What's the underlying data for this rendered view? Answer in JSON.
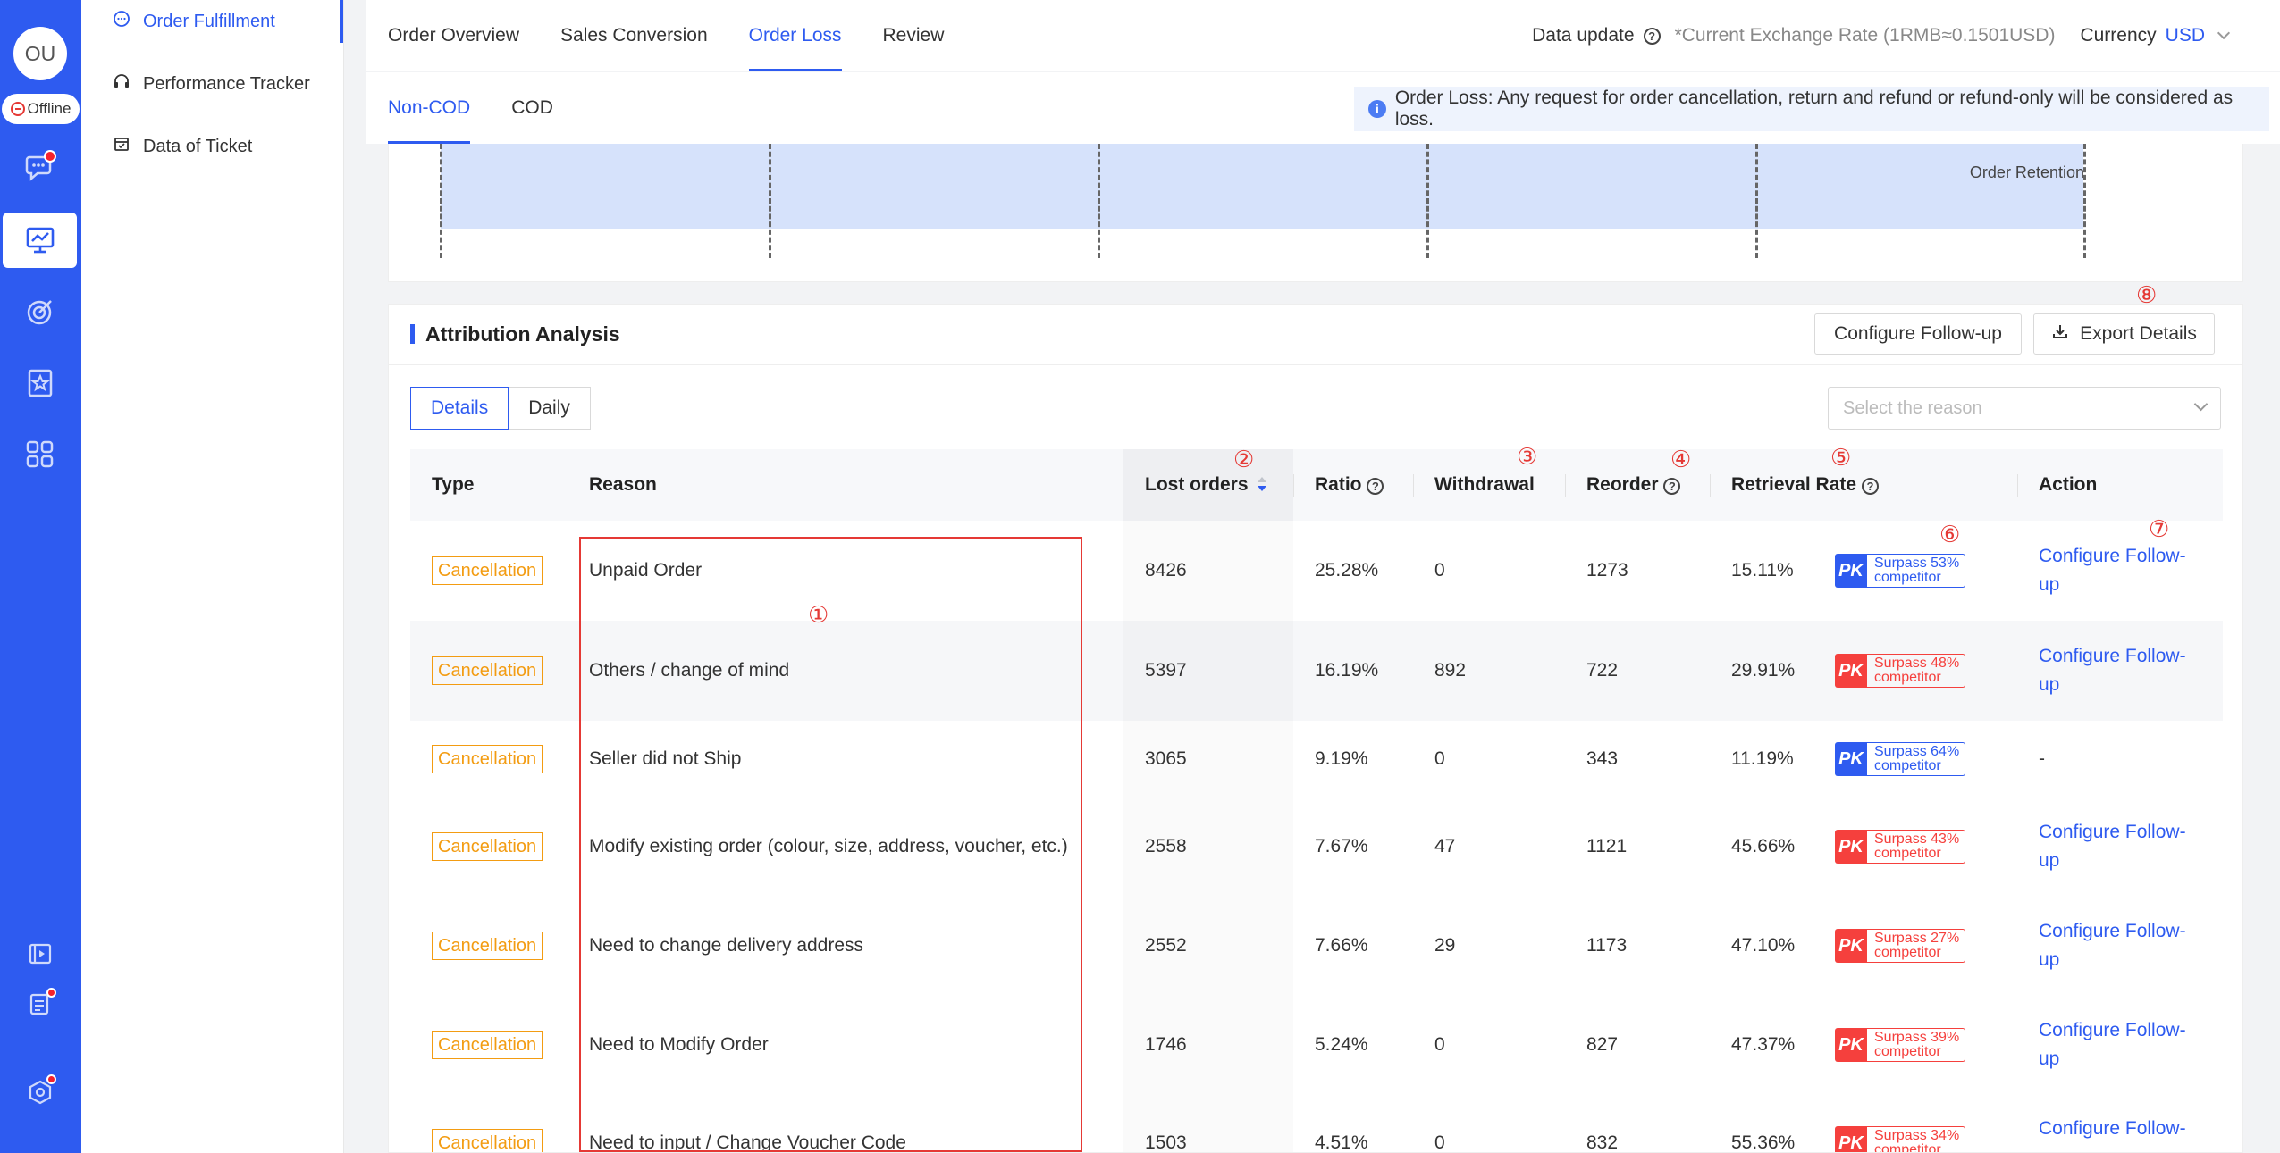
{
  "rail": {
    "avatar": "OU",
    "status": "Offline"
  },
  "subnav": {
    "items": [
      {
        "label": "Order Fulfillment",
        "icon": "chat-bubble-icon"
      },
      {
        "label": "Performance Tracker",
        "icon": "headset-icon"
      },
      {
        "label": "Data of Ticket",
        "icon": "calendar-icon"
      }
    ]
  },
  "topbar": {
    "tabs": [
      "Order Overview",
      "Sales Conversion",
      "Order Loss",
      "Review"
    ],
    "data_update": "Data update",
    "exchange": "*Current Exchange Rate (1RMB≈0.1501USD)",
    "currency_label": "Currency",
    "currency_value": "USD"
  },
  "subbar": {
    "tabs": [
      "Non-COD",
      "COD"
    ],
    "info": "Order Loss: Any request for order cancellation, return and refund or refund-only will be considered as loss."
  },
  "strip": {
    "label": "Order Retention"
  },
  "card": {
    "title": "Attribution Analysis",
    "configure_btn": "Configure Follow-up",
    "export_btn": "Export Details",
    "seg": [
      "Details",
      "Daily"
    ],
    "select_placeholder": "Select the reason"
  },
  "table": {
    "headers": {
      "type": "Type",
      "reason": "Reason",
      "lost": "Lost orders",
      "ratio": "Ratio",
      "withdrawal": "Withdrawal",
      "reorder": "Reorder",
      "retrieval": "Retrieval Rate",
      "action": "Action"
    },
    "rows": [
      {
        "type": "Cancellation",
        "reason": "Unpaid Order",
        "lost": "8426",
        "ratio": "25.28%",
        "withdrawal": "0",
        "reorder": "1273",
        "retrieval": "15.11%",
        "pk_line1": "Surpass 53%",
        "pk_line2": "competitor",
        "pk_color": "blue",
        "action": "Configure Follow-up"
      },
      {
        "type": "Cancellation",
        "reason": "Others / change of mind",
        "lost": "5397",
        "ratio": "16.19%",
        "withdrawal": "892",
        "reorder": "722",
        "retrieval": "29.91%",
        "pk_line1": "Surpass 48%",
        "pk_line2": "competitor",
        "pk_color": "red",
        "action": "Configure Follow-up"
      },
      {
        "type": "Cancellation",
        "reason": "Seller did not Ship",
        "lost": "3065",
        "ratio": "9.19%",
        "withdrawal": "0",
        "reorder": "343",
        "retrieval": "11.19%",
        "pk_line1": "Surpass 64%",
        "pk_line2": "competitor",
        "pk_color": "blue",
        "action": "-"
      },
      {
        "type": "Cancellation",
        "reason": "Modify existing order (colour, size, address, voucher, etc.)",
        "lost": "2558",
        "ratio": "7.67%",
        "withdrawal": "47",
        "reorder": "1121",
        "retrieval": "45.66%",
        "pk_line1": "Surpass 43%",
        "pk_line2": "competitor",
        "pk_color": "red",
        "action": "Configure Follow-up"
      },
      {
        "type": "Cancellation",
        "reason": "Need to change delivery address",
        "lost": "2552",
        "ratio": "7.66%",
        "withdrawal": "29",
        "reorder": "1173",
        "retrieval": "47.10%",
        "pk_line1": "Surpass 27%",
        "pk_line2": "competitor",
        "pk_color": "red",
        "action": "Configure Follow-up"
      },
      {
        "type": "Cancellation",
        "reason": "Need to Modify Order",
        "lost": "1746",
        "ratio": "5.24%",
        "withdrawal": "0",
        "reorder": "827",
        "retrieval": "47.37%",
        "pk_line1": "Surpass 39%",
        "pk_line2": "competitor",
        "pk_color": "red",
        "action": "Configure Follow-up"
      },
      {
        "type": "Cancellation",
        "reason": "Need to input / Change Voucher Code",
        "lost": "1503",
        "ratio": "4.51%",
        "withdrawal": "0",
        "reorder": "832",
        "retrieval": "55.36%",
        "pk_line1": "Surpass 34%",
        "pk_line2": "competitor",
        "pk_color": "red",
        "action": "Configure Follow-up"
      }
    ]
  },
  "annotations": [
    "①",
    "②",
    "③",
    "④",
    "⑤",
    "⑥",
    "⑦",
    "⑧"
  ],
  "colors": {
    "accent": "#2e5bf0",
    "warning": "#f39c12",
    "danger": "#f5403d"
  }
}
